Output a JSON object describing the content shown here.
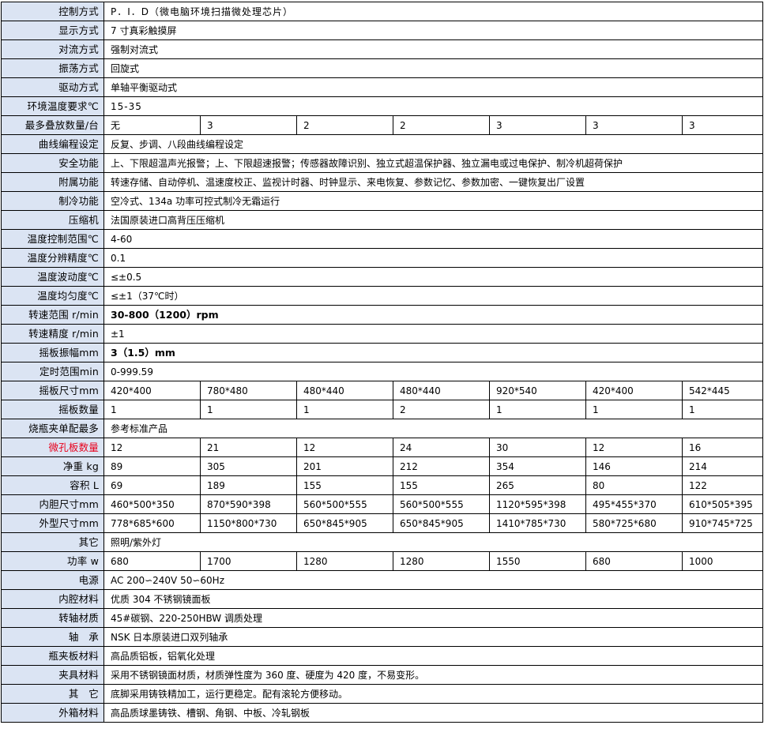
{
  "rows": [
    {
      "label": "控制方式",
      "cells": [
        "P．I．D（微电脑环境扫描微处理芯片）"
      ]
    },
    {
      "label": "显示方式",
      "cells": [
        "7 寸真彩触摸屏"
      ]
    },
    {
      "label": "对流方式",
      "cells": [
        "强制对流式"
      ]
    },
    {
      "label": "振荡方式",
      "cells": [
        "回旋式"
      ]
    },
    {
      "label": "驱动方式",
      "cells": [
        "单轴平衡驱动式"
      ]
    },
    {
      "label": "环境温度要求℃",
      "cells": [
        "15-35"
      ]
    },
    {
      "label": "最多叠放数量/台",
      "cells": [
        "无",
        "3",
        "2",
        "2",
        "3",
        "3",
        "3"
      ]
    },
    {
      "label": "曲线编程设定",
      "cells": [
        "反复、步调、八段曲线编程设定"
      ]
    },
    {
      "label": "安全功能",
      "cells": [
        "上、下限超温声光报警；上、下限超速报警；传感器故障识别、独立式超温保护器、独立漏电或过电保护、制冷机超荷保护"
      ]
    },
    {
      "label": "附属功能",
      "cells": [
        "转速存储、自动停机、温速度校正、监视计时器、时钟显示、来电恢复、参数记忆、参数加密、一键恢复出厂设置"
      ]
    },
    {
      "label": "制冷功能",
      "cells": [
        "空冷式、134a 功率可控式制冷无霜运行"
      ]
    },
    {
      "label": "压缩机",
      "cells": [
        "法国原装进口高背压压缩机"
      ]
    },
    {
      "label": "温度控制范围℃",
      "cells": [
        "4-60"
      ]
    },
    {
      "label": "温度分辨精度℃",
      "cells": [
        "0.1"
      ]
    },
    {
      "label": "温度波动度℃",
      "cells": [
        "≤±0.5"
      ]
    },
    {
      "label": "温度均匀度℃",
      "cells": [
        "≤±1（37℃时）"
      ]
    },
    {
      "label": "转速范围 r/min",
      "cells": [
        "30-800（1200）rpm"
      ]
    },
    {
      "label": "转速精度 r/min",
      "cells": [
        "±1"
      ]
    },
    {
      "label": "摇板振幅mm",
      "cells": [
        "3（1.5）mm"
      ]
    },
    {
      "label": "定时范围min",
      "cells": [
        "0-999.59"
      ]
    },
    {
      "label": "摇板尺寸mm",
      "cells": [
        "420*400",
        "780*480",
        "480*440",
        "480*440",
        "920*540",
        "420*400",
        "542*445"
      ]
    },
    {
      "label": "摇板数量",
      "cells": [
        "1",
        "1",
        "1",
        "2",
        "1",
        "1",
        "1"
      ]
    },
    {
      "label": "烧瓶夹单配最多",
      "cells": [
        "参考标准产品"
      ]
    },
    {
      "label": "微孔板数量",
      "cells": [
        "12",
        "21",
        "12",
        "24",
        "30",
        "12",
        "16"
      ]
    },
    {
      "label": "净重 kg",
      "cells": [
        "89",
        "305",
        "201",
        "212",
        "354",
        "146",
        "214"
      ]
    },
    {
      "label": "容积 L",
      "cells": [
        "69",
        "189",
        "155",
        "155",
        "265",
        "80",
        "122"
      ]
    },
    {
      "label": "内胆尺寸mm",
      "cells": [
        "460*500*350",
        "870*590*398",
        "560*500*555",
        "560*500*555",
        "1120*595*398",
        "495*455*370",
        "610*505*395"
      ]
    },
    {
      "label": "外型尺寸mm",
      "cells": [
        "778*685*600",
        "1150*800*730",
        "650*845*905",
        "650*845*905",
        "1410*785*730",
        "580*725*680",
        "910*745*725"
      ]
    },
    {
      "label": "其它",
      "cells": [
        "照明/紫外灯"
      ]
    },
    {
      "label": "功率 w",
      "cells": [
        "680",
        "1700",
        "1280",
        "1280",
        "1550",
        "680",
        "1000"
      ]
    },
    {
      "label": "电源",
      "cells": [
        "AC 200∽240V 50∽60Hz"
      ]
    },
    {
      "label": "内腔材料",
      "cells": [
        "优质 304 不锈钢镜面板"
      ]
    },
    {
      "label": "转轴材质",
      "cells": [
        "45#碳钢、220-250HBW 调质处理"
      ]
    },
    {
      "label": "轴　承",
      "cells": [
        "NSK 日本原装进口双列轴承"
      ]
    },
    {
      "label": "瓶夹板材料",
      "cells": [
        "高品质铝板，铝氧化处理"
      ]
    },
    {
      "label": "夹具材料",
      "cells": [
        "采用不锈钢镜面材质，材质弹性度为 360 度、硬度为 420 度，不易变形。"
      ]
    },
    {
      "label": "其　它",
      "cells": [
        "底脚采用铸铁精加工，运行更稳定。配有滚轮方便移动。"
      ]
    },
    {
      "label": "外箱材料",
      "cells": [
        "高品质球墨铸铁、槽钢、角钢、中板、冷轧钢板"
      ]
    }
  ],
  "colors": {
    "label_bg": "#dbe4f3",
    "label_red": "#e8001c",
    "border": "#000000"
  }
}
